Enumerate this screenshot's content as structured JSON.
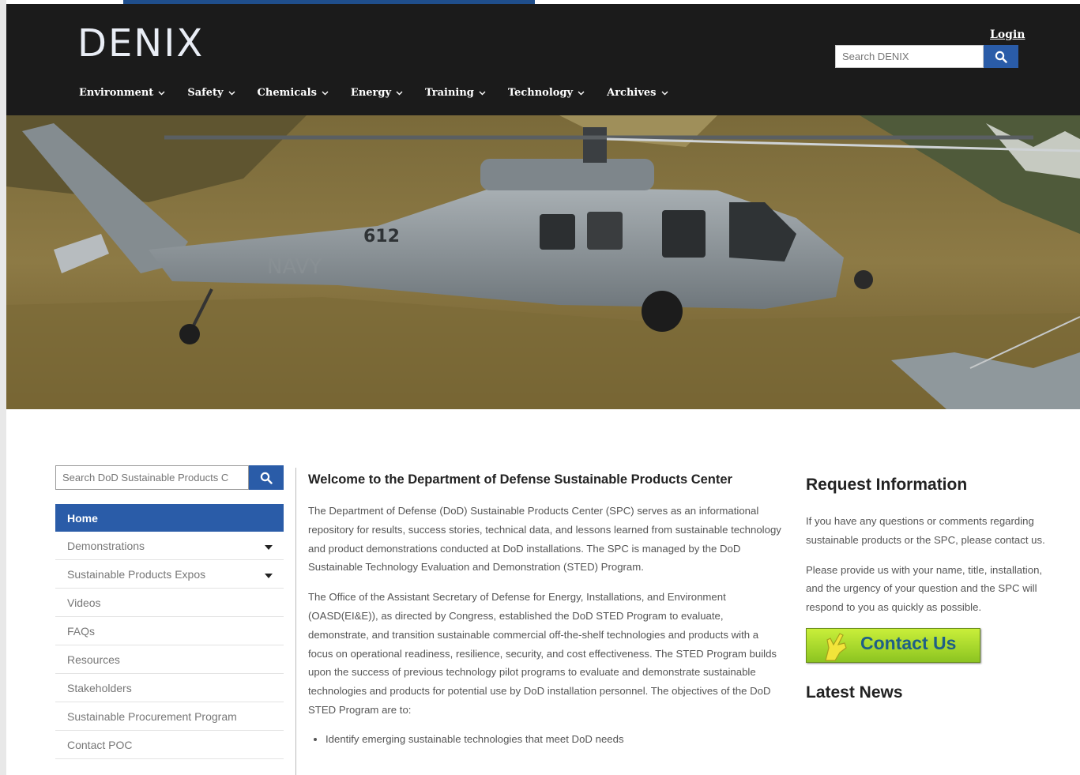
{
  "header": {
    "logo": "DENIX",
    "login": "Login",
    "search_placeholder": "Search DENIX",
    "nav": [
      {
        "label": "Environment"
      },
      {
        "label": "Safety"
      },
      {
        "label": "Chemicals"
      },
      {
        "label": "Energy"
      },
      {
        "label": "Training"
      },
      {
        "label": "Technology"
      },
      {
        "label": "Archives"
      }
    ]
  },
  "hero": {
    "tail_number": "612",
    "tail_text": "NAVY"
  },
  "sidebar": {
    "search_placeholder": "Search DoD Sustainable Products C",
    "items": [
      {
        "label": "Home"
      },
      {
        "label": "Demonstrations"
      },
      {
        "label": "Sustainable Products Expos"
      },
      {
        "label": "Videos"
      },
      {
        "label": "FAQs"
      },
      {
        "label": "Resources"
      },
      {
        "label": "Stakeholders"
      },
      {
        "label": "Sustainable Procurement Program"
      },
      {
        "label": "Contact POC"
      }
    ]
  },
  "main": {
    "title": "Welcome to the Department of Defense Sustainable Products Center",
    "paragraphs": [
      "The Department of Defense (DoD) Sustainable Products Center (SPC) serves as an informational repository for results, success stories, technical data, and lessons learned from sustainable technology and product demonstrations conducted at DoD installations. The SPC is managed by the DoD Sustainable Technology Evaluation and Demonstration (STED) Program.",
      "The Office of the Assistant Secretary of Defense for Energy, Installations, and Environment (OASD(EI&E)), as directed by Congress, established the DoD STED Program to evaluate, demonstrate, and transition sustainable commercial off-the-shelf technologies and products with a focus on operational readiness, resilience, security, and cost effectiveness. The STED Program builds upon the success of previous technology pilot programs to evaluate and demonstrate sustainable technologies and products for potential use by DoD installation personnel. The objectives of the DoD STED Program are to:"
    ],
    "bullets": [
      "Identify emerging sustainable technologies that meet DoD needs"
    ]
  },
  "right": {
    "request_title": "Request Information",
    "p1": "If you have any questions or comments regarding sustainable products or the SPC, please contact us.",
    "p2": "Please provide us with your name, title, installation, and the urgency of your question and the SPC will respond to you as quickly as possible.",
    "contact_label": "Contact Us",
    "latest_title": "Latest News"
  },
  "colors": {
    "header_bg": "#1b1b1b",
    "accent_blue": "#2a5ca8",
    "contact_green": "#9fd52b"
  }
}
